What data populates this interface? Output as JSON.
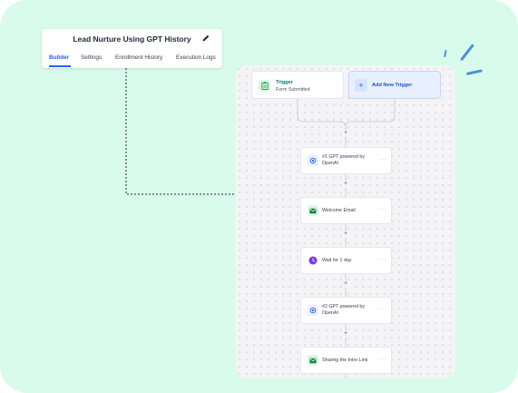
{
  "header": {
    "title": "Lead Nurture Using GPT History",
    "tabs": [
      "Builder",
      "Settings",
      "Enrollment History",
      "Execution Logs"
    ],
    "active_tab": "Builder"
  },
  "trigger": {
    "title": "Trigger",
    "subtitle": "Form Submitted"
  },
  "add_trigger": {
    "label": "Add New Trigger"
  },
  "steps": [
    {
      "label": "#1 GPT powered by OpenAI",
      "icon": "openai-icon"
    },
    {
      "label": "Welcome Email",
      "icon": "email-icon"
    },
    {
      "label": "Wait for 1 day",
      "icon": "clock-icon"
    },
    {
      "label": "#2 GPT powered by OpenAI",
      "icon": "openai-icon"
    },
    {
      "label": "Sharing the Intro Link",
      "icon": "email-icon"
    }
  ],
  "plus_symbol": "+",
  "more_symbol": "···",
  "add_symbol": "+",
  "colors": {
    "background": "#d9fbec",
    "accent": "#2563eb",
    "trigger_green": "#0f766e",
    "wait_purple": "#7c3aed"
  }
}
